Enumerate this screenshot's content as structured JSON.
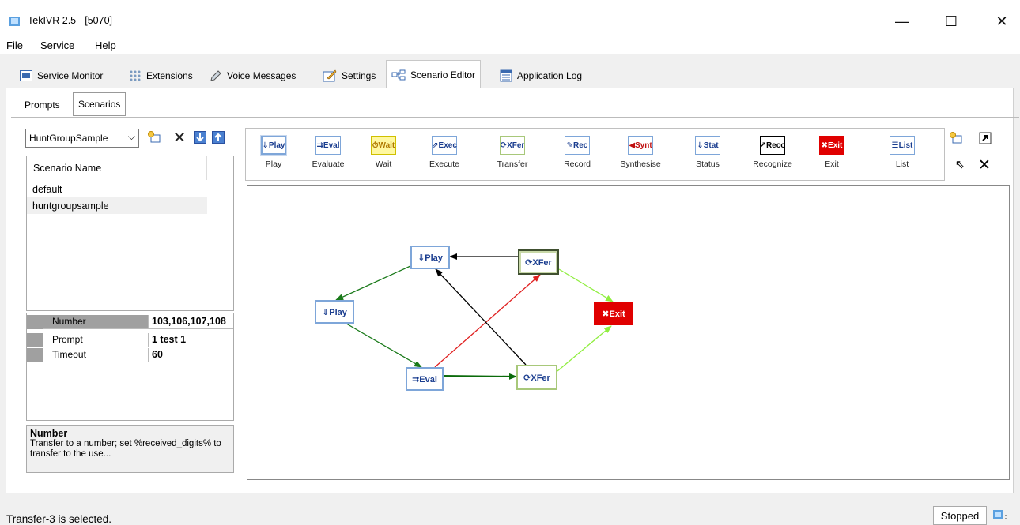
{
  "window": {
    "title": "TekIVR 2.5 - [5070]",
    "minimize": "—",
    "maximize": "☐",
    "close": "✕"
  },
  "menu": [
    {
      "label": "File"
    },
    {
      "label": "Service"
    },
    {
      "label": "Help"
    }
  ],
  "main_tabs": [
    {
      "label": "Service Monitor",
      "icon": "monitor-icon"
    },
    {
      "label": "Extensions",
      "icon": "extensions-icon"
    },
    {
      "label": "Voice Messages",
      "icon": "microphone-icon"
    },
    {
      "label": "Settings",
      "icon": "settings-icon"
    },
    {
      "label": "Scenario Editor",
      "icon": "scenario-editor-icon",
      "active": true
    },
    {
      "label": "Application Log",
      "icon": "log-icon"
    }
  ],
  "sub_tabs": [
    {
      "label": "Prompts"
    },
    {
      "label": "Scenarios",
      "active": true
    }
  ],
  "scenarios": {
    "selected": "HuntGroupSample",
    "column_header": "Scenario Name",
    "items": [
      {
        "name": "default"
      },
      {
        "name": "huntgroupsample",
        "selected": true
      }
    ]
  },
  "properties": [
    {
      "key": "Number",
      "value": "103,106,107,108",
      "selected": true
    },
    {
      "key": "Prompt",
      "value": "1 test 1"
    },
    {
      "key": "Timeout",
      "value": "60"
    }
  ],
  "help": {
    "title": "Number",
    "text": "Transfer to a number; set %received_digits% to transfer to the use..."
  },
  "palette": [
    {
      "icon": "⇓Play",
      "label": "Play",
      "color": "#1a3d8f",
      "bg": "#ffffff",
      "border": "#7ea6d9"
    },
    {
      "icon": "⇉Eval",
      "label": "Evaluate",
      "color": "#1a3d8f",
      "bg": "#ffffff",
      "border": "#7ea6d9"
    },
    {
      "icon": "⏱Wait",
      "label": "Wait",
      "color": "#b07800",
      "bg": "#fff8a0",
      "border": "#d0c000"
    },
    {
      "icon": "⇗Exec",
      "label": "Execute",
      "color": "#1a3d8f",
      "bg": "#ffffff",
      "border": "#7ea6d9"
    },
    {
      "icon": "⟳XFer",
      "label": "Transfer",
      "color": "#1a3d8f",
      "bg": "#ffffff",
      "border": "#a8c87a"
    },
    {
      "icon": "✎Rec",
      "label": "Record",
      "color": "#1a3d8f",
      "bg": "#ffffff",
      "border": "#7ea6d9"
    },
    {
      "icon": "◀Synt",
      "label": "Synthesise",
      "color": "#c01010",
      "bg": "#ffffff",
      "border": "#7ea6d9"
    },
    {
      "icon": "⇓Stat",
      "label": "Status",
      "color": "#1a3d8f",
      "bg": "#ffffff",
      "border": "#7ea6d9"
    },
    {
      "icon": "↗Reco",
      "label": "Recognize",
      "color": "#000000",
      "bg": "#ffffff",
      "border": "#000000"
    },
    {
      "icon": "✖Exit",
      "label": "Exit",
      "color": "#ffffff",
      "bg": "#e00000",
      "border": "#e00000"
    },
    {
      "icon": "☰List",
      "label": "List",
      "color": "#1a3d8f",
      "bg": "#ffffff",
      "border": "#7ea6d9"
    }
  ],
  "diagram": {
    "nodes": [
      {
        "id": "play1",
        "label": "⇓Play",
        "type": "play"
      },
      {
        "id": "play2",
        "label": "⇓Play",
        "type": "play"
      },
      {
        "id": "eval",
        "label": "⇉Eval",
        "type": "evaluate"
      },
      {
        "id": "xfer1",
        "label": "⟳XFer",
        "type": "transfer"
      },
      {
        "id": "xfer2",
        "label": "⟳XFer",
        "type": "transfer"
      },
      {
        "id": "exit",
        "label": "✖Exit",
        "type": "exit"
      }
    ],
    "edges": [
      {
        "from": "xfer1",
        "to": "play1",
        "color": "#000000"
      },
      {
        "from": "play1",
        "to": "play2",
        "color": "#1a7a1a"
      },
      {
        "from": "play2",
        "to": "eval",
        "color": "#1a7a1a"
      },
      {
        "from": "eval",
        "to": "xfer1",
        "color": "#e02020"
      },
      {
        "from": "eval",
        "to": "xfer2",
        "color": "#0a6a0a"
      },
      {
        "from": "xfer2",
        "to": "play1",
        "color": "#000000"
      },
      {
        "from": "xfer1",
        "to": "exit",
        "color": "#90ee40"
      },
      {
        "from": "xfer2",
        "to": "exit",
        "color": "#90ee40"
      }
    ]
  },
  "status": {
    "text": "Transfer-3 is selected.",
    "state": "Stopped"
  }
}
